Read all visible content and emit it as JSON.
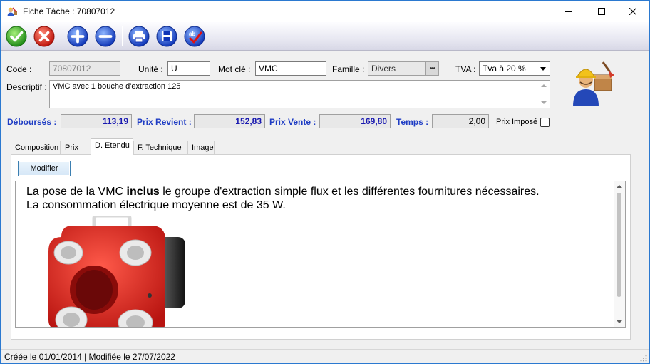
{
  "window": {
    "title": "Fiche Tâche : 70807012"
  },
  "toolbar": {
    "buttons": [
      {
        "name": "validate",
        "icon": "check-icon"
      },
      {
        "name": "cancel",
        "icon": "x-icon"
      },
      {
        "name": "add",
        "icon": "plus-icon"
      },
      {
        "name": "remove",
        "icon": "minus-icon"
      },
      {
        "name": "print",
        "icon": "printer-icon"
      },
      {
        "name": "save",
        "icon": "floppy-icon"
      },
      {
        "name": "spellcheck",
        "icon": "spellcheck-icon"
      }
    ]
  },
  "form": {
    "code_label": "Code :",
    "code_value": "70807012",
    "unite_label": "Unité :",
    "unite_value": "U",
    "motcle_label": "Mot clé :",
    "motcle_value": "VMC",
    "famille_label": "Famille :",
    "famille_value": "Divers",
    "tva_label": "TVA :",
    "tva_value": "Tva à 20 %",
    "descriptif_label": "Descriptif :",
    "descriptif_value": "VMC avec 1 bouche d'extraction 125",
    "debourses_label": "Déboursés :",
    "debourses_value": "113,19",
    "prix_revient_label": "Prix Revient :",
    "prix_revient_value": "152,83",
    "prix_vente_label": "Prix Vente :",
    "prix_vente_value": "169,80",
    "temps_label": "Temps :",
    "temps_value": "2,00",
    "prix_impose_label": "Prix Imposé",
    "prix_impose_checked": false
  },
  "tabs": [
    {
      "label": "Composition",
      "active": false
    },
    {
      "label": "Prix",
      "active": false
    },
    {
      "label": "D. Etendu",
      "active": true
    },
    {
      "label": "F. Technique",
      "active": false
    },
    {
      "label": "Image",
      "active": false
    }
  ],
  "detail": {
    "modify_button": "Modifier",
    "line1_before": "La pose de la VMC ",
    "line1_bold": "inclus",
    "line1_after": " le groupe d'extraction simple flux et les différentes fournitures nécessaires.",
    "line2": "La consommation électrique moyenne est de 35 W."
  },
  "status": {
    "text": "Créée le 01/01/2014 | Modifiée le 27/07/2022"
  },
  "colors": {
    "accent_blue": "#1f3dc4",
    "window_border": "#2b79d0",
    "vmc_red": "#e0312b"
  }
}
